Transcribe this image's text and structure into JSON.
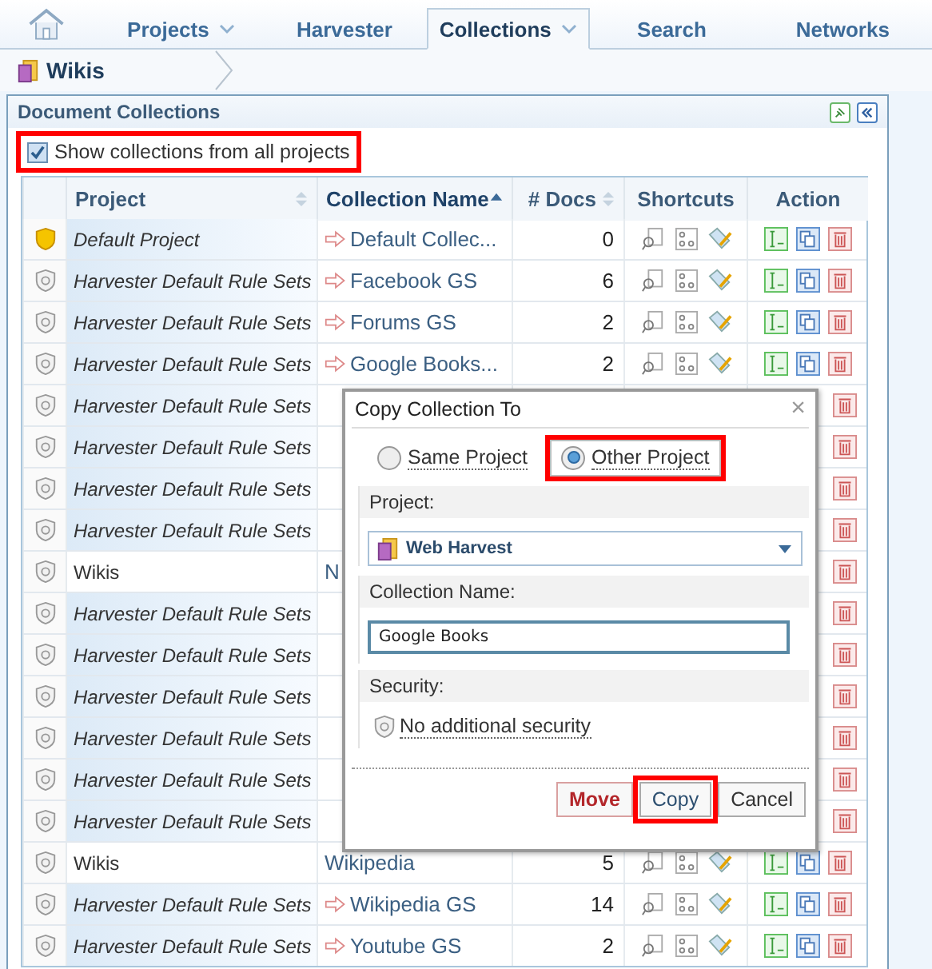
{
  "tabs": [
    {
      "label": "Projects",
      "dropdown": true,
      "selected": false
    },
    {
      "label": "Harvester",
      "dropdown": false,
      "selected": false
    },
    {
      "label": "Collections",
      "dropdown": true,
      "selected": true
    },
    {
      "label": "Search",
      "dropdown": false,
      "selected": false
    },
    {
      "label": "Networks",
      "dropdown": false,
      "selected": false
    }
  ],
  "breadcrumb": "Wikis",
  "panel": {
    "title": "Document Collections",
    "show_all": {
      "label": "Show collections from all projects",
      "checked": true
    },
    "columns": [
      {
        "label": "Project",
        "sortable": true,
        "sorted": false
      },
      {
        "label": "Collection Name",
        "sortable": true,
        "sorted": true
      },
      {
        "label": "# Docs",
        "sortable": true,
        "sorted": false
      },
      {
        "label": "Shortcuts",
        "sortable": false
      },
      {
        "label": "Action",
        "sortable": false
      }
    ],
    "rows": [
      {
        "kind": "full",
        "default": true,
        "current": false,
        "project": "Default Project",
        "collection": "Default Collec...",
        "docs": "0"
      },
      {
        "kind": "full",
        "default": false,
        "current": false,
        "project": "Harvester Default Rule Sets",
        "collection": "Facebook GS",
        "docs": "6"
      },
      {
        "kind": "full",
        "default": false,
        "current": false,
        "project": "Harvester Default Rule Sets",
        "collection": "Forums GS",
        "docs": "2"
      },
      {
        "kind": "full",
        "default": false,
        "current": false,
        "project": "Harvester Default Rule Sets",
        "collection": "Google Books...",
        "docs": "2"
      },
      {
        "kind": "covered",
        "default": false,
        "current": false,
        "project": "Harvester Default Rule Sets"
      },
      {
        "kind": "covered",
        "default": false,
        "current": false,
        "project": "Harvester Default Rule Sets"
      },
      {
        "kind": "covered",
        "default": false,
        "current": false,
        "project": "Harvester Default Rule Sets"
      },
      {
        "kind": "covered",
        "default": false,
        "current": false,
        "project": "Harvester Default Rule Sets"
      },
      {
        "kind": "covered",
        "default": false,
        "current": true,
        "project": "Wikis",
        "collection": "N"
      },
      {
        "kind": "covered",
        "default": false,
        "current": false,
        "project": "Harvester Default Rule Sets"
      },
      {
        "kind": "covered",
        "default": false,
        "current": false,
        "project": "Harvester Default Rule Sets"
      },
      {
        "kind": "covered",
        "default": false,
        "current": false,
        "project": "Harvester Default Rule Sets"
      },
      {
        "kind": "covered",
        "default": false,
        "current": false,
        "project": "Harvester Default Rule Sets"
      },
      {
        "kind": "covered",
        "default": false,
        "current": false,
        "project": "Harvester Default Rule Sets"
      },
      {
        "kind": "covered",
        "default": false,
        "current": false,
        "project": "Harvester Default Rule Sets"
      },
      {
        "kind": "full",
        "default": false,
        "current": true,
        "project": "Wikis",
        "collection": "Wikipedia",
        "docs": "5"
      },
      {
        "kind": "full",
        "default": false,
        "current": false,
        "project": "Harvester Default Rule Sets",
        "collection": "Wikipedia GS",
        "docs": "14"
      },
      {
        "kind": "full",
        "default": false,
        "current": false,
        "project": "Harvester Default Rule Sets",
        "collection": "Youtube GS",
        "docs": "2"
      }
    ]
  },
  "dialog": {
    "title": "Copy Collection To",
    "close": "×",
    "options": [
      {
        "label": "Same Project",
        "selected": false
      },
      {
        "label": "Other Project",
        "selected": true
      }
    ],
    "project_label": "Project:",
    "project_value": "Web Harvest",
    "name_label": "Collection Name:",
    "name_value": "Google Books",
    "security_label": "Security:",
    "security_value": "No additional security",
    "buttons": [
      {
        "label": "Move",
        "kind": "danger",
        "highlighted": false
      },
      {
        "label": "Copy",
        "kind": "primary",
        "highlighted": true
      },
      {
        "label": "Cancel",
        "kind": "plain",
        "highlighted": false
      }
    ]
  }
}
